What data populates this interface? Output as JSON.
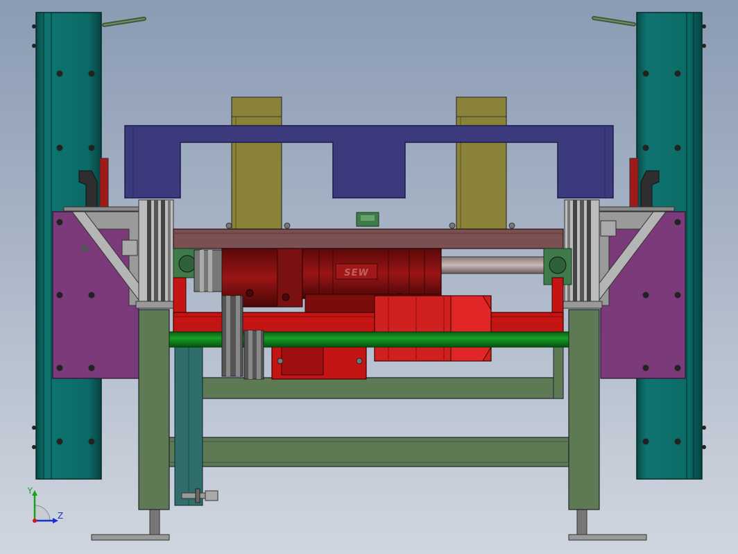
{
  "viewport": {
    "background": [
      "#8a9bb3",
      "#d0d6df"
    ]
  },
  "motor": {
    "brand_label": "SEW"
  },
  "triad": {
    "y_label": "Y",
    "z_label": "Z",
    "x_axis_color": "#d01818",
    "y_axis_color": "#1aa01a",
    "z_axis_color": "#1a2fd0"
  },
  "colors": {
    "column": "#0d6d6a",
    "column_dark": "#07423f",
    "plate": "#7b3a7a",
    "crossbeam": "#3a3a7a",
    "post": "#8a8238",
    "frame": "#5d7a55",
    "red_frame": "#c41414",
    "motor": "#8a1212",
    "shaft_green": "#0b7a16",
    "steel": "#8f8f8f",
    "brown_rail": "#7a5050"
  }
}
